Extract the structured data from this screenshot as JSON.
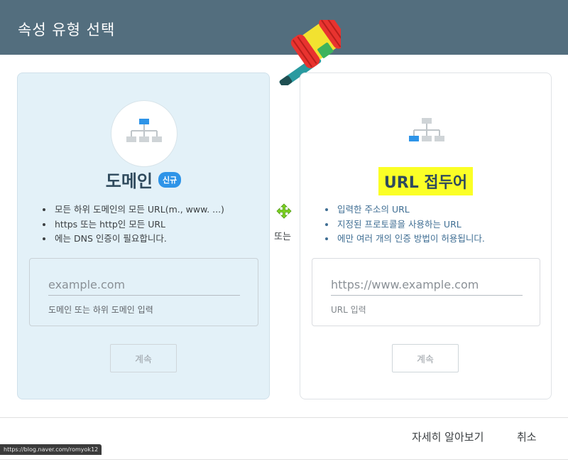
{
  "header": {
    "title": "속성 유형 선택"
  },
  "domain_card": {
    "title": "도메인",
    "badge": "신규",
    "bullets": [
      "모든 하위 도메인의 모든 URL(m., www. ...)",
      "https 또는 http인 모든 URL",
      "에는 DNS 인증이 필요합니다."
    ],
    "input": {
      "placeholder": "example.com",
      "value": "",
      "hint": "도메인 또는 하위 도메인 입력"
    },
    "continue_label": "계속"
  },
  "separator": {
    "or_label": "또는"
  },
  "url_card": {
    "title": "URL 접두어",
    "bullets": [
      "입력한 주소의 URL",
      "지정된 프로토콜을 사용하는 URL",
      "에만 여러 개의 인증 방법이 허용됩니다."
    ],
    "input": {
      "placeholder": "https://www.example.com",
      "value": "",
      "hint": "URL 입력"
    },
    "continue_label": "계속"
  },
  "footer": {
    "learn_more_label": "자세히 알아보기",
    "cancel_label": "취소"
  },
  "status_bar": {
    "url": "https://blog.naver.com/romyok12"
  },
  "colors": {
    "header_bg": "#536e7e",
    "domain_card_bg": "#e3f1f8",
    "badge_bg": "#2e94e8",
    "highlight": "#fbff26"
  }
}
